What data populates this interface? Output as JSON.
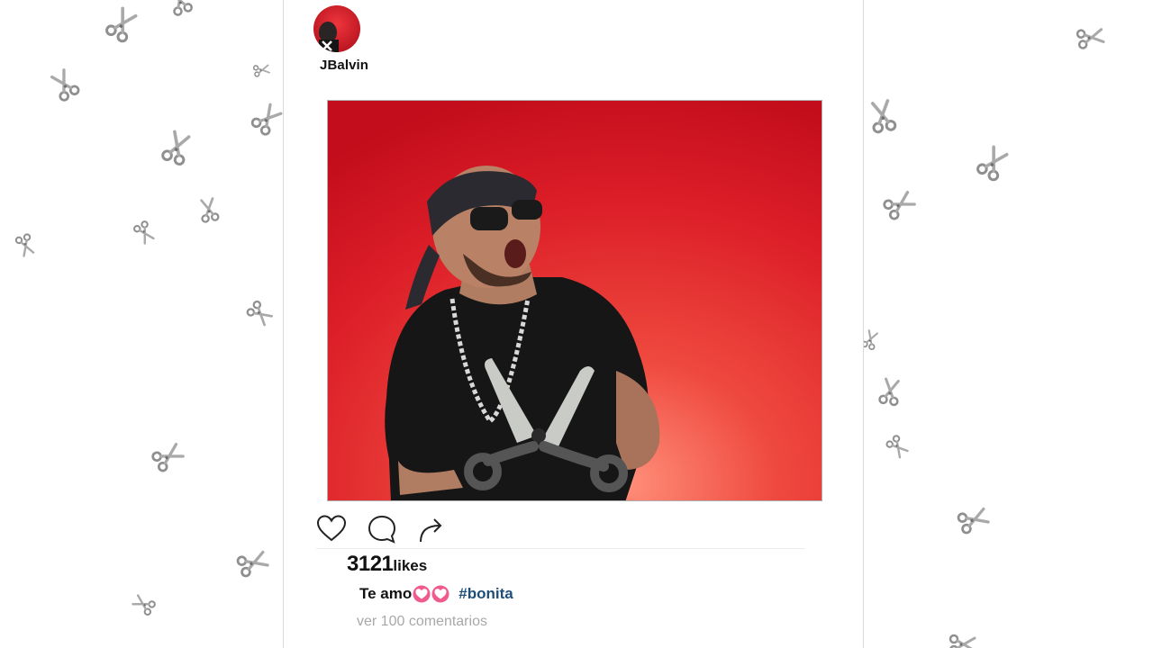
{
  "post": {
    "username": "JBalvin",
    "likes_count": "3121",
    "likes_label": "likes",
    "caption_text": "Te amo",
    "caption_emojis": [
      "heart-emoji",
      "heart-emoji"
    ],
    "hashtag": "#bonita",
    "comments_link": "ver 100 comentarios"
  },
  "actions": [
    {
      "name": "like",
      "icon": "heart-outline-icon"
    },
    {
      "name": "comment",
      "icon": "speech-bubble-icon"
    },
    {
      "name": "share",
      "icon": "share-arrow-icon"
    }
  ],
  "colors": {
    "image_background": "#e0212b",
    "hashtag": "#1f4e79",
    "comments_link": "#a8a8a8",
    "heart_emoji": "#f05a8c",
    "scissors_graphic": "#c9ccc6"
  }
}
